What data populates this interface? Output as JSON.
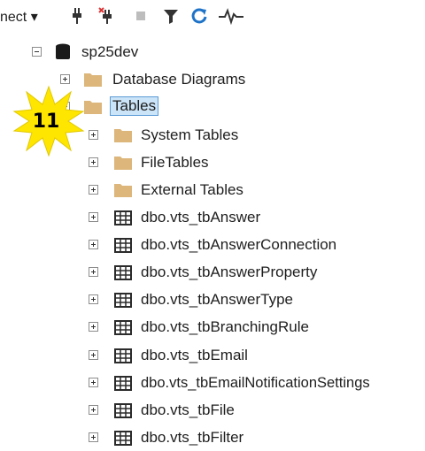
{
  "toolbar": {
    "connect_label": "nect",
    "icons": [
      "connect-dropdown-icon",
      "disconnect-icon",
      "disconnect-all-icon",
      "stop-icon",
      "filter-icon",
      "refresh-icon",
      "activity-monitor-icon"
    ]
  },
  "tree": {
    "server": {
      "label": "sp25dev",
      "icon": "database-icon"
    },
    "database_diagrams": {
      "label": "Database Diagrams",
      "icon": "folder-icon"
    },
    "tables": {
      "label": "Tables",
      "icon": "folder-icon",
      "selected": true
    },
    "subfolders": [
      {
        "label": "System Tables"
      },
      {
        "label": "FileTables"
      },
      {
        "label": "External Tables"
      }
    ],
    "table_items": [
      {
        "label": "dbo.vts_tbAnswer"
      },
      {
        "label": "dbo.vts_tbAnswerConnection"
      },
      {
        "label": "dbo.vts_tbAnswerProperty"
      },
      {
        "label": "dbo.vts_tbAnswerType"
      },
      {
        "label": "dbo.vts_tbBranchingRule"
      },
      {
        "label": "dbo.vts_tbEmail"
      },
      {
        "label": "dbo.vts_tbEmailNotificationSettings"
      },
      {
        "label": "dbo.vts_tbFile"
      },
      {
        "label": "dbo.vts_tbFilter"
      }
    ]
  },
  "annotation": {
    "step_number": "11"
  },
  "colors": {
    "folder": "#dcb67a",
    "selection_bg": "#cce4f7",
    "selection_border": "#5b9bd5",
    "badge_fill": "#ffe600",
    "refresh_icon": "#1e73c8"
  }
}
